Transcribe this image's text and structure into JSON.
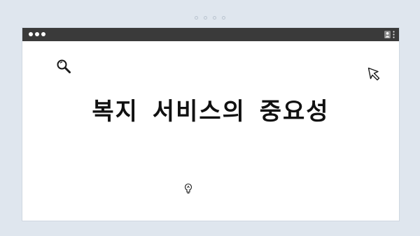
{
  "page": {
    "heading": "복지 서비스의 중요성"
  },
  "icons": {
    "top_indicator": "dots-indicator",
    "window_controls": "window-dots-icon",
    "user": "user-icon",
    "menu": "kebab-menu-icon",
    "search": "search-icon",
    "cursor": "cursor-icon",
    "bulb": "lightbulb-icon"
  },
  "colors": {
    "background": "#dfe6ee",
    "titlebar": "#3a3a3a",
    "window": "#ffffff",
    "text": "#111111"
  }
}
